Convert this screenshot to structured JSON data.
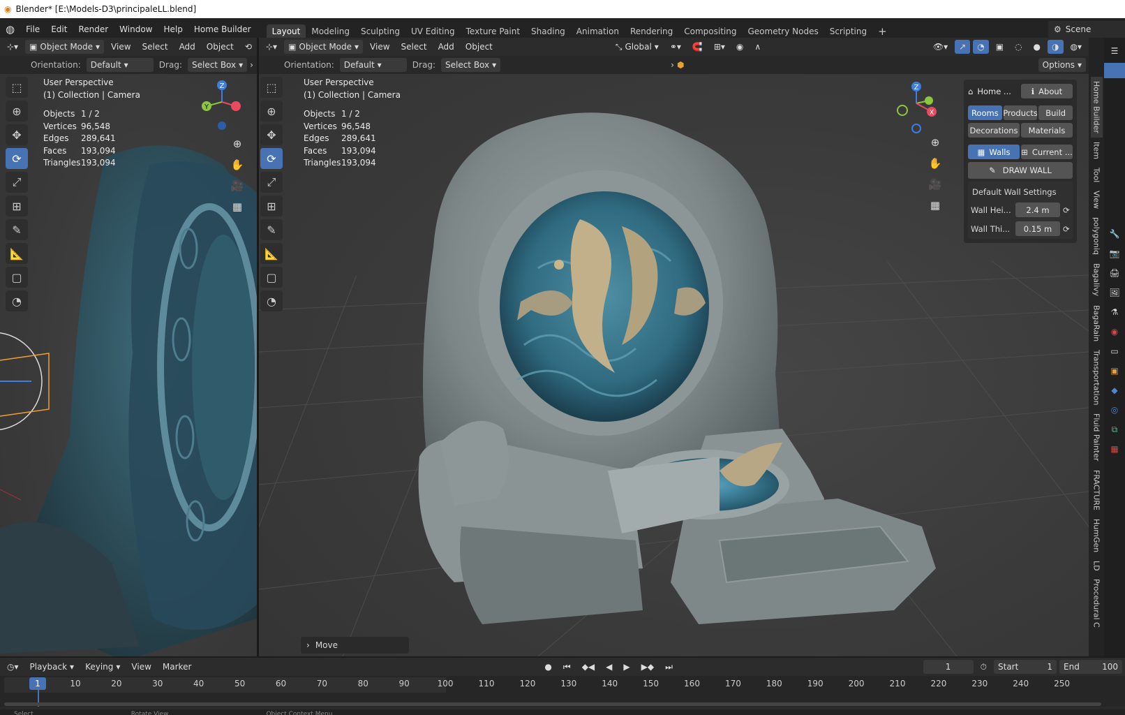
{
  "window": {
    "title": "Blender* [E:\\Models-D3\\principaleLL.blend]"
  },
  "menu": {
    "items": [
      "File",
      "Edit",
      "Render",
      "Window",
      "Help",
      "Home Builder"
    ],
    "workspaces": [
      "Layout",
      "Modeling",
      "Sculpting",
      "UV Editing",
      "Texture Paint",
      "Shading",
      "Animation",
      "Rendering",
      "Compositing",
      "Geometry Nodes",
      "Scripting"
    ],
    "active_workspace": "Layout",
    "add_tab": "+",
    "scene": "Scene"
  },
  "left_view": {
    "mode": "Object Mode",
    "menus": [
      "View",
      "Select",
      "Add",
      "Object"
    ],
    "orientation_label": "Orientation:",
    "orientation_value": "Default",
    "drag_label": "Drag:",
    "drag_value": "Select Box",
    "overlay_title": "User Perspective",
    "overlay_sub": "(1) Collection | Camera"
  },
  "main_view": {
    "mode": "Object Mode",
    "menus": [
      "View",
      "Select",
      "Add",
      "Object"
    ],
    "transform_space": "Global",
    "orientation_label": "Orientation:",
    "orientation_value": "Default",
    "drag_label": "Drag:",
    "drag_value": "Select Box",
    "options": "Options",
    "overlay_title": "User Perspective",
    "overlay_sub": "(1) Collection | Camera",
    "last_op": "Move"
  },
  "stats": {
    "labels": [
      "Objects",
      "Vertices",
      "Edges",
      "Faces",
      "Triangles"
    ],
    "values": [
      "1 / 2",
      "96,548",
      "289,641",
      "193,094",
      "193,094"
    ]
  },
  "gizmo": {
    "x": "X",
    "y": "Y",
    "z": "Z"
  },
  "home_builder": {
    "home": "Home ...",
    "about": "About",
    "tabs_row1": [
      "Rooms",
      "Products",
      "Build"
    ],
    "tabs_row2": [
      "Decorations",
      "Materials"
    ],
    "walls": "Walls",
    "current": "Current ...",
    "draw_wall": "DRAW WALL",
    "settings_title": "Default Wall Settings",
    "wall_height_label": "Wall Hei...",
    "wall_height_value": "2.4 m",
    "wall_thickness_label": "Wall Thi...",
    "wall_thickness_value": "0.15 m"
  },
  "side_tabs": [
    "Home Builder",
    "Item",
    "Tool",
    "View",
    "polygoniq",
    "Bagalivy",
    "BagaRain",
    "Transportation",
    "Fluid Painter",
    "FRACTURE",
    "HumGen",
    "LD",
    "Procedural C"
  ],
  "timeline": {
    "menus": [
      "Playback",
      "Keying",
      "View",
      "Marker"
    ],
    "current_frame": "1",
    "start_label": "Start",
    "start_value": "1",
    "end_label": "End",
    "end_value": "100",
    "ruler": [
      "1",
      "10",
      "20",
      "30",
      "40",
      "50",
      "60",
      "70",
      "80",
      "90",
      "100",
      "110",
      "120",
      "130",
      "140",
      "150",
      "160",
      "170",
      "180",
      "190",
      "200",
      "210",
      "220",
      "230",
      "240",
      "250"
    ],
    "status": [
      "Select",
      "Rotate View",
      "Object Context Menu"
    ]
  },
  "colors": {
    "accent": "#4772b3",
    "x_axis": "#e84a5f",
    "y_axis": "#8cc63f",
    "z_axis": "#3d7ee0"
  }
}
